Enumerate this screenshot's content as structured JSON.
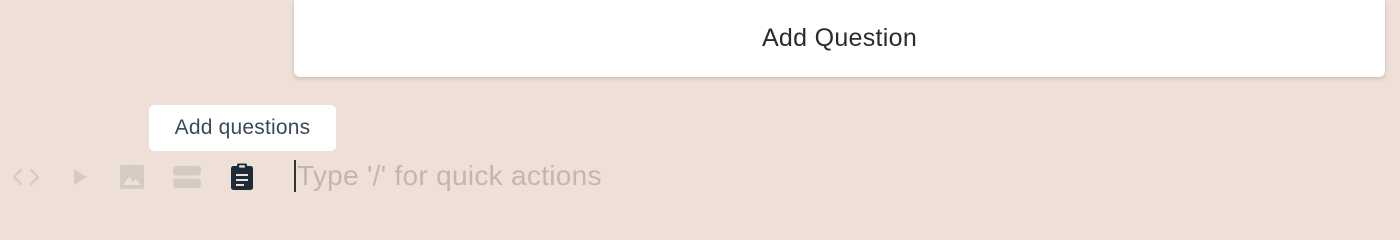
{
  "card": {
    "add_question_label": "Add Question"
  },
  "tooltip": {
    "text": "Add questions"
  },
  "toolbar": {
    "items": [
      {
        "name": "code",
        "icon": "code-icon",
        "state": "inactive"
      },
      {
        "name": "play",
        "icon": "play-icon",
        "state": "inactive"
      },
      {
        "name": "image",
        "icon": "image-icon",
        "state": "inactive"
      },
      {
        "name": "layout",
        "icon": "layout-icon",
        "state": "inactive"
      },
      {
        "name": "questions",
        "icon": "clipboard-icon",
        "state": "active"
      }
    ]
  },
  "editor": {
    "value": "",
    "placeholder": "Type '/' for quick actions"
  },
  "colors": {
    "background": "#eee0d7",
    "icon_inactive": "#d6cbc3",
    "icon_active": "#1e2a38",
    "placeholder": "#c2b6ad"
  }
}
